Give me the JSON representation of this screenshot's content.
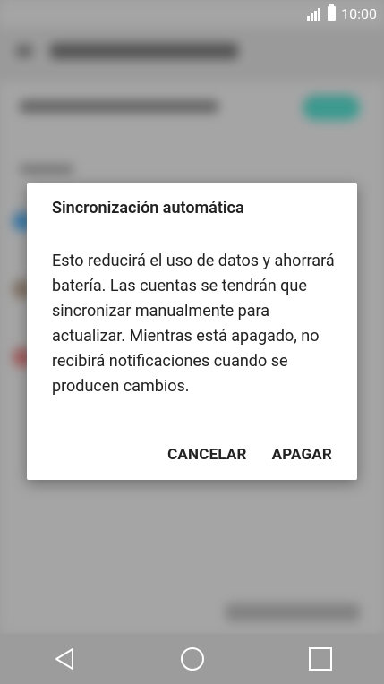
{
  "status_bar": {
    "time": "10:00",
    "icons": [
      "signal-icon",
      "battery-icon"
    ]
  },
  "dialog": {
    "title": "Sincronización automática",
    "message": "Esto reducirá el uso de datos y ahorrará batería. Las cuentas se tendrán que sincronizar manualmente para actualizar. Mientras está apagado, no recibirá notificaciones cuando se producen cambios.",
    "cancel_label": "CANCELAR",
    "confirm_label": "APAGAR"
  },
  "nav_bar": {
    "icons": [
      "back-icon",
      "home-icon",
      "recents-icon"
    ]
  },
  "colors": {
    "toggle_accent": "#3ea69a",
    "dialog_bg": "#ffffff",
    "nav_bg": "#9c9c9c"
  }
}
